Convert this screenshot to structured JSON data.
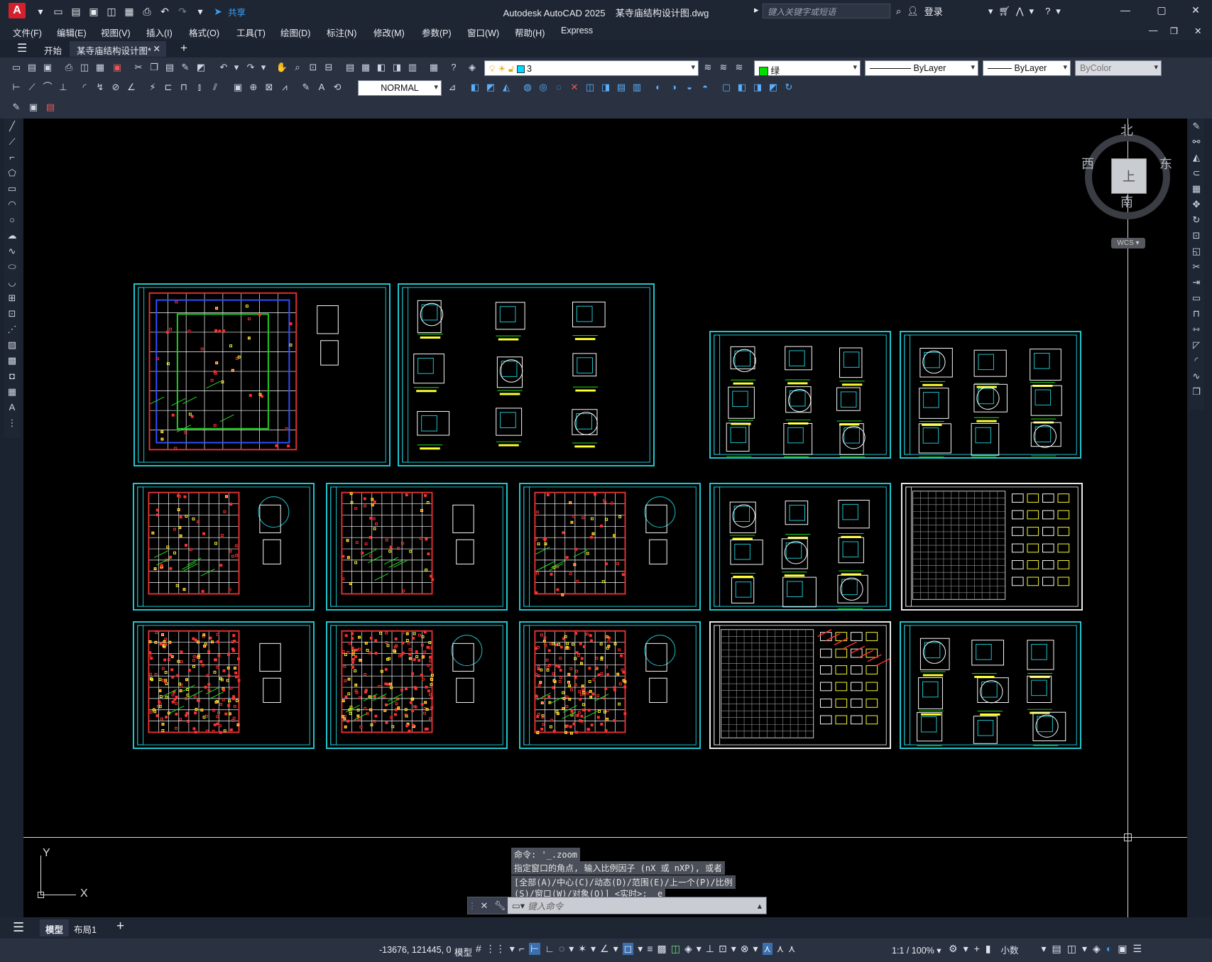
{
  "window": {
    "app_title": "Autodesk AutoCAD 2025",
    "file_title": "某寺庙结构设计图.dwg",
    "share_label": "共享",
    "search_placeholder": "键入关键字或短语",
    "login_label": "登录",
    "app_logo": "A"
  },
  "menu": [
    "文件(F)",
    "编辑(E)",
    "视图(V)",
    "插入(I)",
    "格式(O)",
    "工具(T)",
    "绘图(D)",
    "标注(N)",
    "修改(M)",
    "参数(P)",
    "窗口(W)",
    "帮助(H)",
    "Express"
  ],
  "tabs": {
    "start": "开始",
    "active": "某寺庙结构设计图*",
    "close": "✕",
    "add": "+"
  },
  "properties": {
    "layer": "3",
    "color": "绿",
    "color_hex": "#00e000",
    "linetype": "ByLayer",
    "lineweight": "ByLayer",
    "plotstyle": "ByColor",
    "style": "NORMAL"
  },
  "viewcube": {
    "north": "北",
    "south": "南",
    "east": "东",
    "west": "西",
    "face": "上",
    "wcs": "WCS"
  },
  "ucs": {
    "x": "X",
    "y": "Y"
  },
  "command": {
    "history": [
      "命令: '_.zoom",
      "指定窗口的角点, 输入比例因子 (nX 或 nXP), 或者",
      "[全部(A)/中心(C)/动态(D)/范围(E)/上一个(P)/比例",
      "(S)/窗口(W)/对象(O)] <实时>: _e"
    ],
    "placeholder": "键入命令"
  },
  "layout_tabs": {
    "model": "模型",
    "layout1": "布局1",
    "add": "+"
  },
  "status": {
    "coords": "-13676, 121445, 0",
    "mode": "模型",
    "scale": "1:1 / 100%",
    "units": "小数"
  },
  "colors": {
    "canvas": "#000000",
    "sheet_border": "#1fc6cf",
    "accent_red": "#d4202c",
    "ui_dark": "#1f2633"
  }
}
